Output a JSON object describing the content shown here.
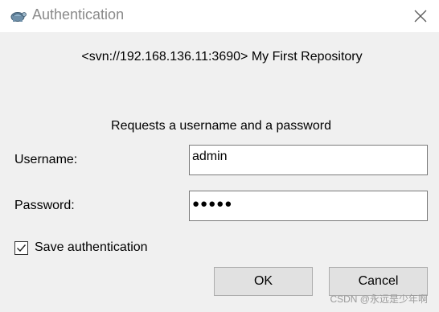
{
  "window": {
    "title": "Authentication",
    "icon": "tortoise-svn-icon",
    "close_icon": "close-icon"
  },
  "dialog": {
    "realm": "<svn://192.168.136.11:3690> My First Repository",
    "prompt": "Requests a username and a password",
    "username_label": "Username:",
    "username_value": "admin",
    "password_label": "Password:",
    "password_value": "●●●●●",
    "save_auth_label": "Save authentication",
    "save_auth_checked": true,
    "ok_label": "OK",
    "cancel_label": "Cancel"
  },
  "watermark": "CSDN @永远是少年啊",
  "colors": {
    "titlebar": "#ffffff",
    "dialog_bg": "#f0f0f0",
    "title_text": "#8a8a8a",
    "button_bg": "#e1e1e1"
  }
}
